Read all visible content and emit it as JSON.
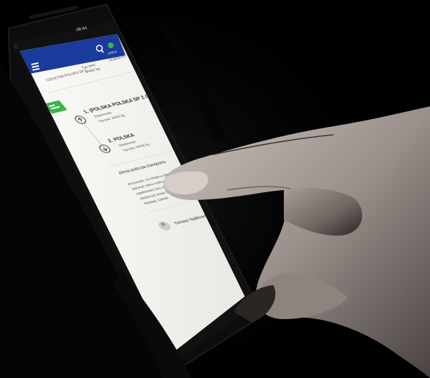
{
  "status_bar": {
    "time": "08:44"
  },
  "app_bar": {
    "status_label": "online"
  },
  "top_row": {
    "company_line": "CZESZYNA POLSKA SP Z",
    "type": "Typ pow.",
    "weight": "34432 kg",
    "id_line": "123456 PL"
  },
  "orders": [
    {
      "number": "1.",
      "title": "(POLSKA POLSKA SP Z O.O",
      "line1": "Wiadomości",
      "line2": "Typ pow. 34432 kg"
    },
    {
      "number": "2.",
      "title": "POLSKA",
      "line1": "Wiadomości",
      "line2": "Typ pow. 34432 kg"
    }
  ],
  "section": {
    "heading": "zlenia podczas transportu",
    "body_lines": [
      "przyczepie, na miejscu załadunku proszę",
      "dokonać stanu rozliczeń. Pamiętaj musi być",
      "zapakowany bez odbiór od odbiorcy. Podpis mus",
      "dostarczyć towar bez zapewne, bez odbiór miej",
      "dostawy. Zakład."
    ]
  },
  "contact": {
    "name": "Tomasz Nalikowski"
  },
  "colors": {
    "app_bar": "#1a3a9c",
    "accent_green": "#3bb54a",
    "screen_bg": "#f4f4f0"
  }
}
